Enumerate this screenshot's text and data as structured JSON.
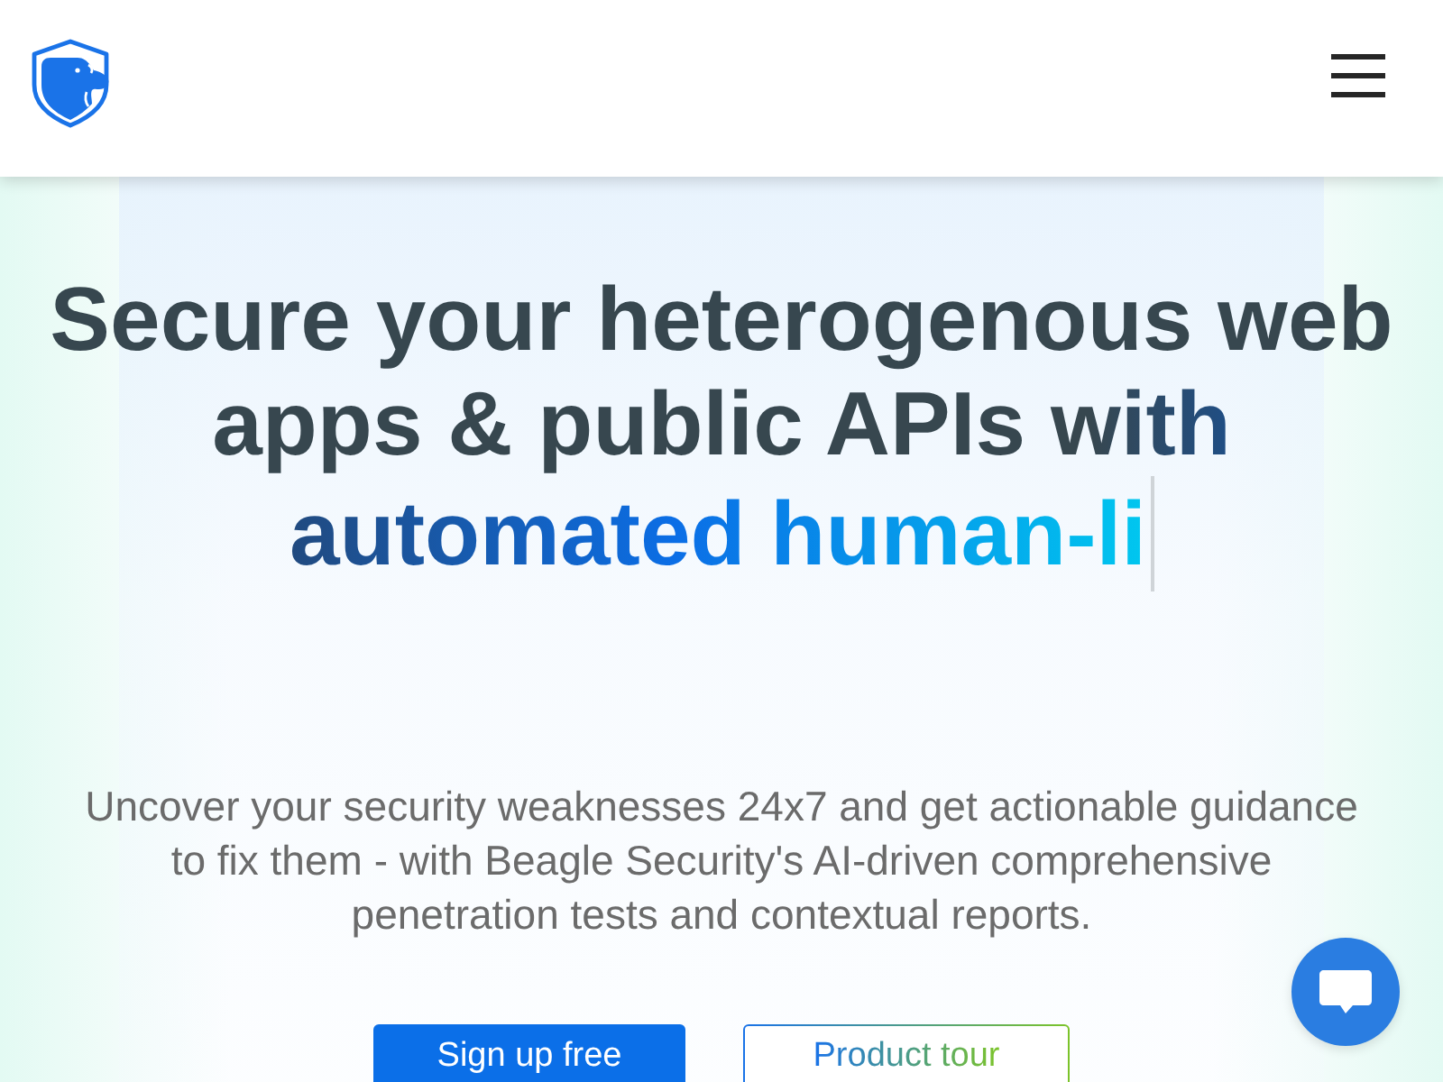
{
  "hero": {
    "headline": "Secure your heterogenous web apps & public APIs with",
    "typed_text": "automated human-li",
    "description": "Uncover your security weaknesses 24x7 and get actionable guidance to fix them - with Beagle Security's AI-driven comprehensive penetration tests and contextual reports.",
    "buttons": [
      {
        "label": "Sign up free",
        "kind": "primary"
      },
      {
        "label": "Product tour",
        "kind": "outline"
      }
    ]
  }
}
